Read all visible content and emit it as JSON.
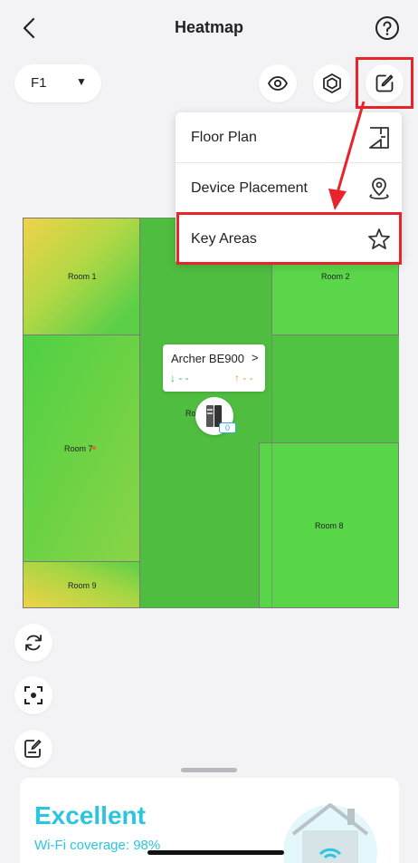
{
  "header": {
    "title": "Heatmap",
    "back_icon": "chevron-left-icon",
    "help_icon": "help-icon"
  },
  "floor": {
    "selected": "F1",
    "caret": "▼"
  },
  "toolbar": {
    "view_icon": "eye-icon",
    "device_icon": "hexagon-icon",
    "edit_icon": "edit-icon"
  },
  "menu": {
    "items": [
      {
        "label": "Floor Plan",
        "icon": "floor-plan-icon"
      },
      {
        "label": "Device Placement",
        "icon": "location-pin-icon"
      },
      {
        "label": "Key Areas",
        "icon": "star-icon"
      }
    ]
  },
  "map": {
    "rooms": [
      {
        "label": "Room 1"
      },
      {
        "label": "Room 2"
      },
      {
        "label": "Room 7"
      },
      {
        "label": "Room 8"
      },
      {
        "label": "Room 9"
      },
      {
        "label": "Ro"
      }
    ]
  },
  "device": {
    "name": "Archer BE900",
    "chevron": ">",
    "download": "↓ - -",
    "upload": "↑ - -",
    "badge": "0"
  },
  "side_tools": {
    "refresh_icon": "refresh-icon",
    "focus_icon": "focus-icon",
    "edit_icon": "note-edit-icon"
  },
  "summary": {
    "status": "Excellent",
    "coverage": "Wi-Fi coverage: 98%",
    "image_icon": "house-wifi-icon"
  },
  "colors": {
    "accent": "#2bc6de",
    "highlight": "#e8232a",
    "heat_green": "#5cd048",
    "heat_yellow": "#f2d645"
  }
}
